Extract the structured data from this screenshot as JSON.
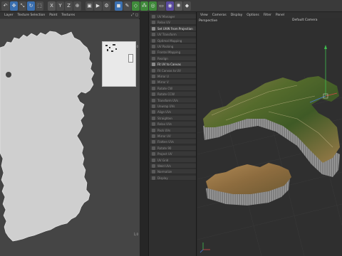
{
  "toolbar": {
    "buttons": [
      {
        "icon": "undo-icon"
      },
      {
        "icon": "move-icon"
      },
      {
        "icon": "scale-icon"
      },
      {
        "icon": "rotate-icon"
      },
      {
        "icon": "select-icon"
      },
      {
        "icon": "x-axis-icon",
        "label": "X"
      },
      {
        "icon": "y-axis-icon",
        "label": "Y"
      },
      {
        "icon": "z-axis-icon",
        "label": "Z"
      },
      {
        "icon": "coord-icon"
      },
      {
        "icon": "render-view-icon"
      },
      {
        "icon": "render-icon"
      },
      {
        "icon": "render-settings-icon"
      },
      {
        "icon": "cube-icon"
      },
      {
        "icon": "pen-icon"
      },
      {
        "icon": "subdivide-icon"
      },
      {
        "icon": "array-icon"
      },
      {
        "icon": "deformer-icon"
      },
      {
        "icon": "floor-icon"
      },
      {
        "icon": "camera-icon"
      },
      {
        "icon": "light-icon"
      },
      {
        "icon": "tag-icon"
      }
    ]
  },
  "uv_editor": {
    "menu": [
      "Layer",
      "Texture Selection",
      "Paint",
      "Textures"
    ],
    "coord_top_right": "1,0",
    "coord_bottom_right": "1,0"
  },
  "layer_panel": {
    "rows": [
      {
        "label": "UV Manager",
        "bright": false
      },
      {
        "label": "Relax UV",
        "bright": false
      },
      {
        "label": "Set UVW From Projection",
        "bright": true
      },
      {
        "label": "UV Transform",
        "bright": false
      },
      {
        "label": "Optimal Mapping",
        "bright": false
      },
      {
        "label": "UV Packing",
        "bright": false
      },
      {
        "label": "Frontal Mapping",
        "bright": false
      },
      {
        "label": "Realign",
        "bright": false
      },
      {
        "label": "Fit UV to Canvas",
        "bright": true
      },
      {
        "label": "Fit Canvas to UV",
        "bright": false
      },
      {
        "label": "Mirror U",
        "bright": false
      },
      {
        "label": "Mirror V",
        "bright": false
      },
      {
        "label": "Rotate CW",
        "bright": false
      },
      {
        "label": "Rotate CCW",
        "bright": false
      },
      {
        "label": "Transform UVs",
        "bright": false
      },
      {
        "label": "Unwrap UVs",
        "bright": false
      },
      {
        "label": "Align UVs",
        "bright": false
      },
      {
        "label": "Straighten",
        "bright": false
      },
      {
        "label": "Relax UVs",
        "bright": false
      },
      {
        "label": "Pack UVs",
        "bright": false
      },
      {
        "label": "Mirror UV",
        "bright": false
      },
      {
        "label": "Flatten UVs",
        "bright": false
      },
      {
        "label": "Rotate 90",
        "bright": false
      },
      {
        "label": "Project UV",
        "bright": false
      },
      {
        "label": "UV Grid",
        "bright": false
      },
      {
        "label": "Weld UVs",
        "bright": false
      },
      {
        "label": "Normalize",
        "bright": false
      },
      {
        "label": "Display",
        "bright": false
      }
    ]
  },
  "viewport": {
    "menu": [
      "View",
      "Cameras",
      "Display",
      "Options",
      "Filter",
      "Panel"
    ],
    "view_name": "Perspective",
    "camera_name": "Default Camera"
  }
}
